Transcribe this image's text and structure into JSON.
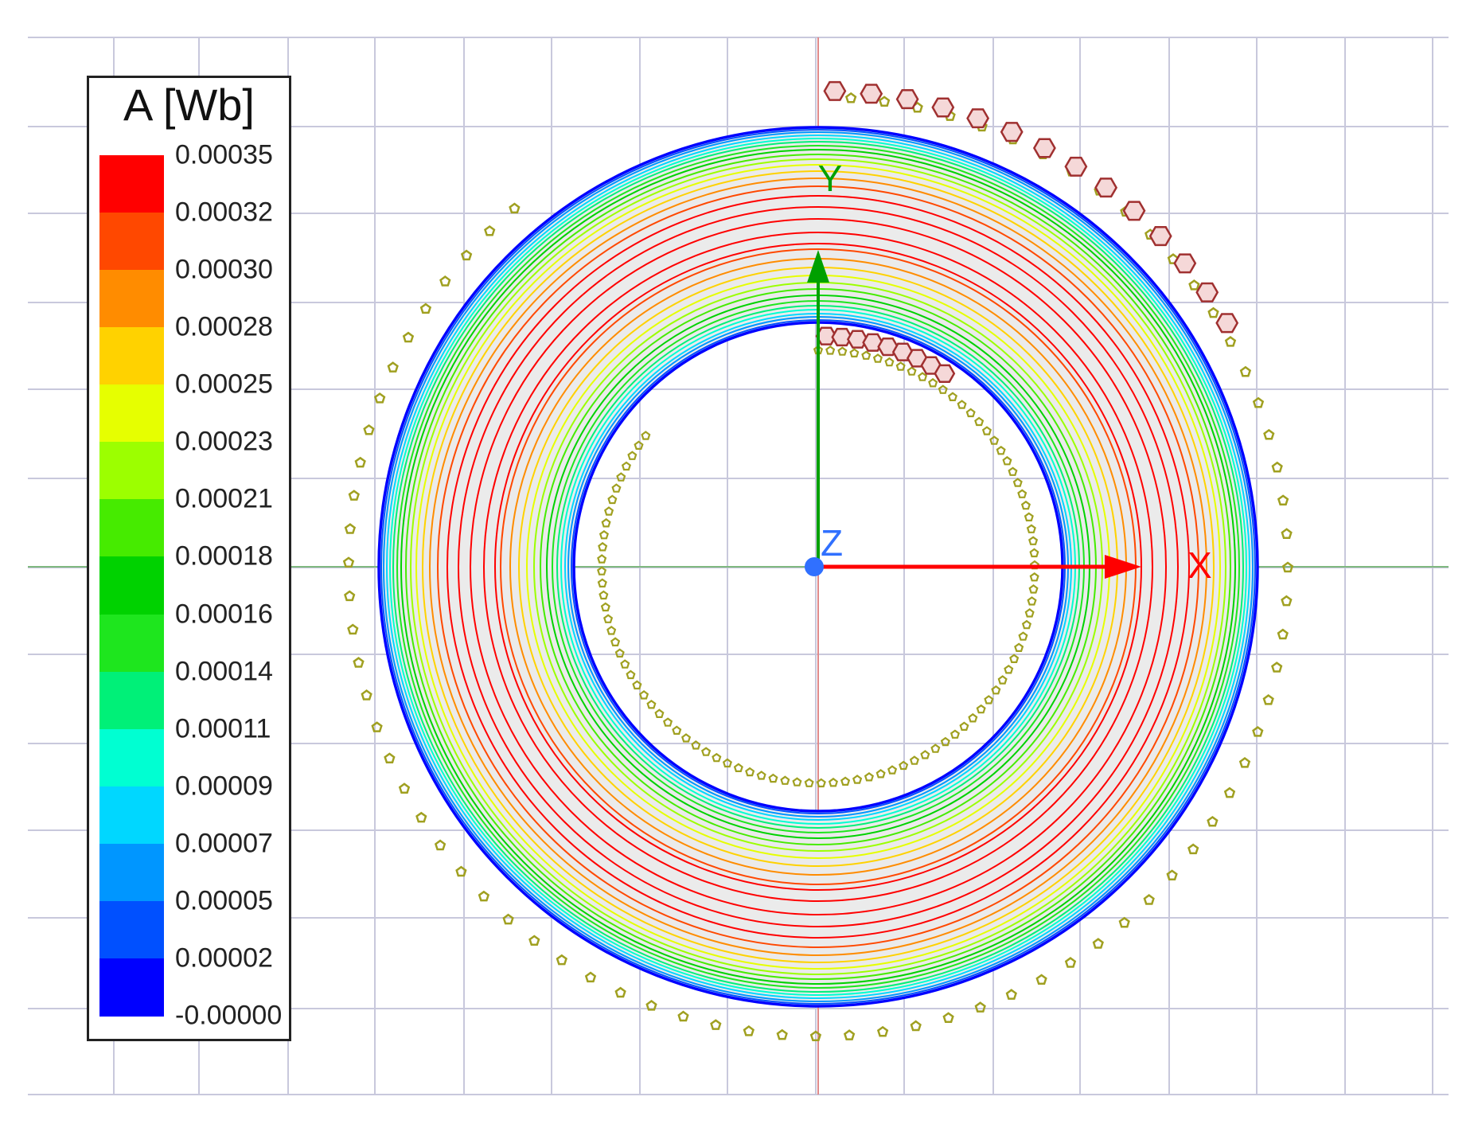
{
  "legend": {
    "title": "A [Wb]",
    "labels": [
      "0.00035",
      "0.00032",
      "0.00030",
      "0.00028",
      "0.00025",
      "0.00023",
      "0.00021",
      "0.00018",
      "0.00016",
      "0.00014",
      "0.00011",
      "0.00009",
      "0.00007",
      "0.00005",
      "0.00002",
      "-0.00000"
    ],
    "colors": [
      "#ff0000",
      "#ff4800",
      "#ff8c00",
      "#ffd200",
      "#e6ff00",
      "#9cff00",
      "#46eb00",
      "#00d200",
      "#1ee61e",
      "#00f078",
      "#00ffd2",
      "#00d7ff",
      "#0096ff",
      "#0050ff",
      "#0000ff"
    ]
  },
  "axes": {
    "x_label": "X",
    "y_label": "Y",
    "z_label": "Z",
    "x_color": "#ff0000",
    "y_color": "#00a000",
    "z_color": "#3070ff"
  },
  "contour_colors": [
    "#0000ff",
    "#0050ff",
    "#0096ff",
    "#00d7ff",
    "#00ffd2",
    "#00f078",
    "#1ee61e",
    "#00d200",
    "#46eb00",
    "#9cff00",
    "#e6ff00",
    "#ffd200",
    "#ff8c00",
    "#ff4800",
    "#ff0000"
  ],
  "colors": {
    "grid": "#c8c8dc",
    "core_fill": "#ebebeb",
    "winding_marker": "#a0a020",
    "conductor_marker": "#a03030",
    "conductor_fill": "#f5d8d8"
  }
}
